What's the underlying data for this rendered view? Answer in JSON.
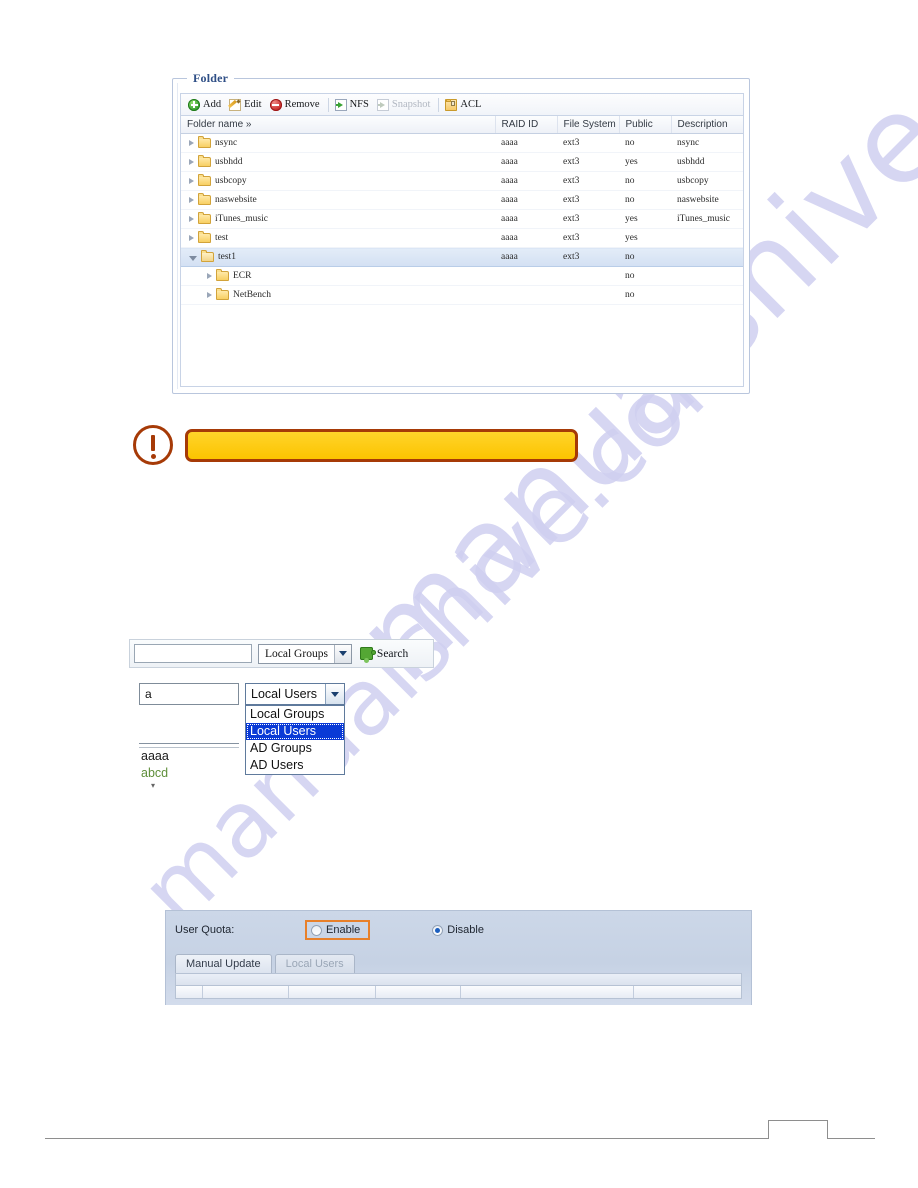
{
  "watermark": {
    "line1": "manualshive.com",
    "line2": "manualshive.com"
  },
  "folder_panel": {
    "legend": "Folder",
    "toolbar": [
      {
        "label": "Add",
        "icon": "add-circle-icon",
        "disabled": false
      },
      {
        "label": "Edit",
        "icon": "pencil-edit-icon",
        "disabled": false
      },
      {
        "label": "Remove",
        "icon": "remove-circle-icon",
        "disabled": false
      },
      {
        "label": "NFS",
        "icon": "nfs-page-icon",
        "disabled": false
      },
      {
        "label": "Snapshot",
        "icon": "snapshot-page-icon",
        "disabled": true
      },
      {
        "label": "ACL",
        "icon": "acl-folder-lock-icon",
        "disabled": false
      }
    ],
    "columns": [
      "Folder name »",
      "RAID ID",
      "File System",
      "Public",
      "Description"
    ],
    "rows": [
      {
        "name": "nsync",
        "raid_id": "aaaa",
        "file_system": "ext3",
        "public": "no",
        "description": "nsync",
        "level": 0,
        "expanded": false,
        "selected": false
      },
      {
        "name": "usbhdd",
        "raid_id": "aaaa",
        "file_system": "ext3",
        "public": "yes",
        "description": "usbhdd",
        "level": 0,
        "expanded": false,
        "selected": false
      },
      {
        "name": "usbcopy",
        "raid_id": "aaaa",
        "file_system": "ext3",
        "public": "no",
        "description": "usbcopy",
        "level": 0,
        "expanded": false,
        "selected": false
      },
      {
        "name": "naswebsite",
        "raid_id": "aaaa",
        "file_system": "ext3",
        "public": "no",
        "description": "naswebsite",
        "level": 0,
        "expanded": false,
        "selected": false
      },
      {
        "name": "iTunes_music",
        "raid_id": "aaaa",
        "file_system": "ext3",
        "public": "yes",
        "description": "iTunes_music",
        "level": 0,
        "expanded": false,
        "selected": false
      },
      {
        "name": "test",
        "raid_id": "aaaa",
        "file_system": "ext3",
        "public": "yes",
        "description": "",
        "level": 0,
        "expanded": false,
        "selected": false
      },
      {
        "name": "test1",
        "raid_id": "aaaa",
        "file_system": "ext3",
        "public": "no",
        "description": "",
        "level": 0,
        "expanded": true,
        "selected": true
      },
      {
        "name": "ECR",
        "raid_id": "",
        "file_system": "",
        "public": "no",
        "description": "",
        "level": 1,
        "expanded": false,
        "selected": false
      },
      {
        "name": "NetBench",
        "raid_id": "",
        "file_system": "",
        "public": "no",
        "description": "",
        "level": 1,
        "expanded": false,
        "selected": false
      }
    ]
  },
  "note_callout": {
    "icon": "exclamation-mark-icon",
    "text": ""
  },
  "search_bar": {
    "input_value": "",
    "input_placeholder": "",
    "selected_scope": "Local Groups",
    "search_label": "Search",
    "search_icon": "green-puzzle-icon"
  },
  "search_dropdown": {
    "input_value": "a",
    "selected_value": "Local Users",
    "options": [
      "Local Groups",
      "Local Users",
      "AD Groups",
      "AD Users"
    ],
    "selected_index": 1,
    "results": [
      {
        "label": "aaaa",
        "style": "a"
      },
      {
        "label": "abcd",
        "style": "b"
      }
    ]
  },
  "quota_panel": {
    "label": "User Quota:",
    "enable_label": "Enable",
    "enable_selected": false,
    "disable_label": "Disable",
    "disable_selected": true,
    "tabs": [
      {
        "label": "Manual Update",
        "active": true
      },
      {
        "label": "Local Users",
        "active": false
      }
    ]
  },
  "footer": {
    "page_number": ""
  },
  "colors": {
    "panel_border": "#b9c6dd",
    "legend_text": "#2f4f86",
    "callout_fill": "#fcc400",
    "callout_border": "#a63a07",
    "dropdown_highlight": "#0a3ad6",
    "annotation_orange": "#e8802a",
    "watermark": "#cfcff0"
  }
}
